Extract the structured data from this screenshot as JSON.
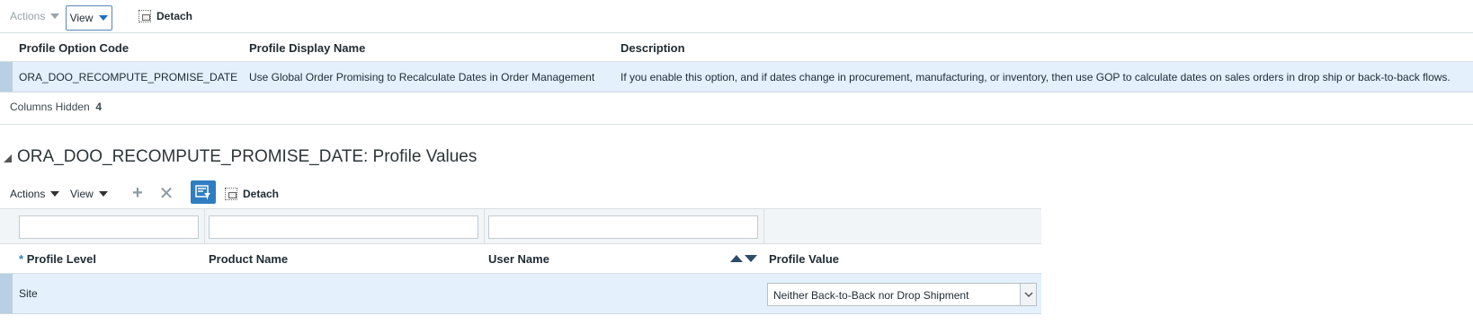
{
  "toolbar1": {
    "actions_label": "Actions",
    "view_label": "View",
    "detach_label": "Detach"
  },
  "table1": {
    "headers": [
      "Profile Option Code",
      "Profile Display Name",
      "Description"
    ],
    "row": {
      "code": "ORA_DOO_RECOMPUTE_PROMISE_DATE",
      "display_name": "Use Global Order Promising to Recalculate Dates in Order Management",
      "description": "If you enable this option, and if dates change in procurement, manufacturing, or inventory, then use GOP to calculate dates on sales orders in drop ship or back-to-back flows."
    },
    "columns_hidden_label": "Columns Hidden",
    "columns_hidden_count": "4"
  },
  "section2": {
    "title": "ORA_DOO_RECOMPUTE_PROMISE_DATE: Profile Values"
  },
  "toolbar2": {
    "actions_label": "Actions",
    "view_label": "View",
    "add_icon": "plus-icon",
    "delete_icon": "x-icon",
    "qbe_icon": "query-by-example-icon",
    "detach_label": "Detach"
  },
  "table2": {
    "filters": [
      "",
      "",
      ""
    ],
    "headers": {
      "required_marker": "*",
      "profile_level": "Profile Level",
      "product_name": "Product Name",
      "user_name": "User Name",
      "profile_value": "Profile Value"
    },
    "row": {
      "profile_level": "Site",
      "product_name": "",
      "user_name": "",
      "profile_value": "Neither Back-to-Back nor Drop Shipment"
    }
  },
  "colors": {
    "selected_row": "#e4f0fb",
    "accent": "#2f7ec1"
  }
}
